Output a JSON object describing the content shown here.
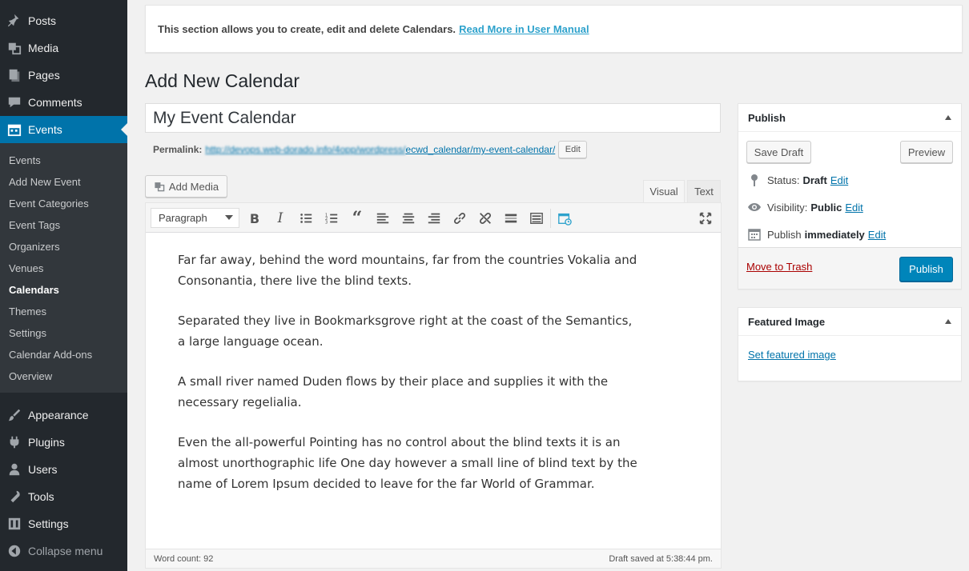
{
  "sidebar": {
    "top_items": [
      {
        "label": "Posts",
        "icon": "pin-icon"
      },
      {
        "label": "Media",
        "icon": "media-icon"
      },
      {
        "label": "Pages",
        "icon": "pages-icon"
      },
      {
        "label": "Comments",
        "icon": "comments-icon"
      },
      {
        "label": "Events",
        "icon": "calendar-icon",
        "current": true
      }
    ],
    "submenu": [
      "Events",
      "Add New Event",
      "Event Categories",
      "Event Tags",
      "Organizers",
      "Venues",
      "Calendars",
      "Themes",
      "Settings",
      "Calendar Add-ons",
      "Overview"
    ],
    "active_submenu": "Calendars",
    "bottom_items": [
      {
        "label": "Appearance",
        "icon": "brush-icon"
      },
      {
        "label": "Plugins",
        "icon": "plugin-icon"
      },
      {
        "label": "Users",
        "icon": "users-icon"
      },
      {
        "label": "Tools",
        "icon": "wrench-icon"
      },
      {
        "label": "Settings",
        "icon": "settings-icon"
      },
      {
        "label": "Collapse menu",
        "icon": "collapse-icon"
      }
    ]
  },
  "notice": {
    "text": "This section allows you to create, edit and delete Calendars.",
    "link": "Read More in User Manual"
  },
  "page_title": "Add New Calendar",
  "title_field": {
    "value": "My Event Calendar"
  },
  "permalink": {
    "label": "Permalink:",
    "base_url": "http://devops.web-dorado.info/4opp/wordpress/",
    "slug_url": "ecwd_calendar/my-event-calendar/",
    "edit_label": "Edit"
  },
  "editor": {
    "add_media_label": "Add Media",
    "tabs": {
      "visual": "Visual",
      "text": "Text"
    },
    "format_select": "Paragraph",
    "paragraphs": [
      "Far far away, behind the word mountains, far from the countries Vokalia and Consonantia, there live the blind texts.",
      "Separated they live in Bookmarksgrove right at the coast of the Semantics, a large language ocean.",
      "A small river named Duden flows by their place and supplies it with the necessary regelialia.",
      "Even the all-powerful Pointing has no control about the blind texts it is an almost unorthographic life One day however a small line of blind text by the name of Lorem Ipsum decided to leave for the far World of Grammar."
    ],
    "word_count": "Word count: 92",
    "draft_saved": "Draft saved at 5:38:44 pm."
  },
  "publish_box": {
    "title": "Publish",
    "save_draft": "Save Draft",
    "preview": "Preview",
    "status_label": "Status:",
    "status_value": "Draft",
    "visibility_label": "Visibility:",
    "visibility_value": "Public",
    "publish_label": "Publish",
    "publish_value": "immediately",
    "edit_label": "Edit",
    "trash_label": "Move to Trash",
    "publish_button": "Publish"
  },
  "featured_box": {
    "title": "Featured Image",
    "link": "Set featured image"
  },
  "colors": {
    "sidebar_bg": "#23282d",
    "submenu_bg": "#32373c",
    "accent": "#0073aa",
    "publish_button": "#0085ba",
    "trash": "#a00"
  }
}
